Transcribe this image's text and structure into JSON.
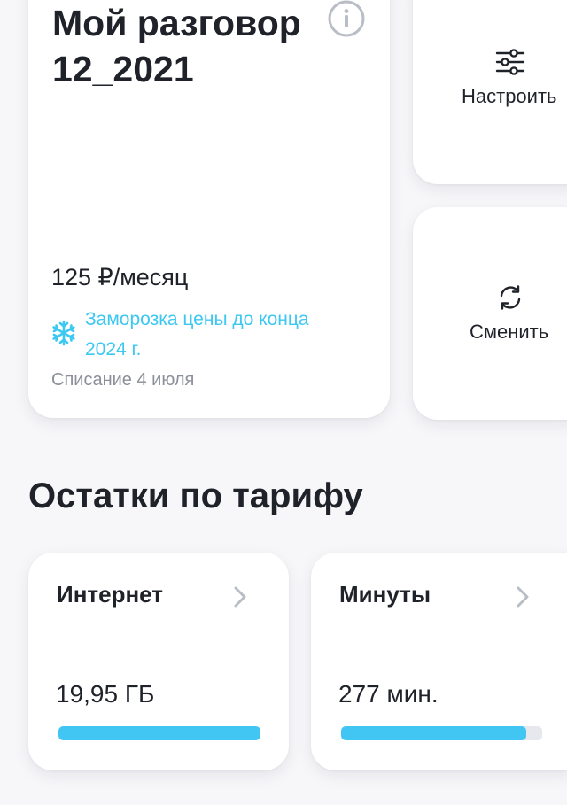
{
  "tariff": {
    "title": "Мой разговор 12_2021",
    "price": "125 ₽/месяц",
    "freeze_note": "Заморозка цены до конца 2024 г.",
    "charge_date": "Списание 4 июля"
  },
  "actions": {
    "configure_label": "Настроить",
    "change_label": "Сменить"
  },
  "balances": {
    "section_title": "Остатки по тарифу",
    "internet": {
      "title": "Интернет",
      "value": "19,95 ГБ",
      "fill": 1.0
    },
    "minutes": {
      "title": "Минуты",
      "value": "277 мин.",
      "fill": 0.92
    }
  },
  "colors": {
    "accent": "#3cc8f0",
    "bar_fill": "#41c6f3",
    "bar_track": "#e6e8ee",
    "text_primary": "#1f2229",
    "text_secondary": "#8a8f99"
  },
  "icons": {
    "info": "info-circle-icon",
    "snow": "snowflake-icon",
    "configure": "sliders-icon",
    "change": "refresh-icon",
    "chevron": "chevron-right-icon"
  }
}
